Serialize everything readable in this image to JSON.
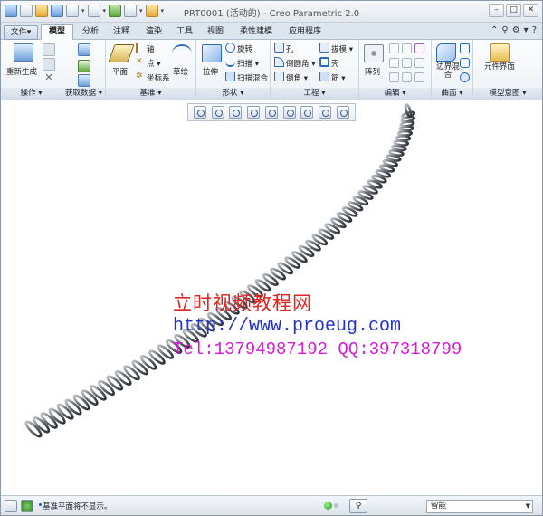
{
  "window": {
    "title": "PRT0001 (活动的) - Creo Parametric 2.0"
  },
  "tabs": [
    {
      "label": "文件",
      "dropdown": "▾"
    },
    {
      "label": "模型"
    },
    {
      "label": "分析"
    },
    {
      "label": "注释"
    },
    {
      "label": "渲染"
    },
    {
      "label": "工具"
    },
    {
      "label": "视图"
    },
    {
      "label": "柔性建模"
    },
    {
      "label": "应用程序"
    }
  ],
  "ribbon": {
    "groups": {
      "operations": "操作 ▾",
      "get_data": "获取数据 ▾",
      "datum": "基准 ▾",
      "shape": "形状 ▾",
      "engineering": "工程 ▾",
      "edit": "编辑 ▾",
      "surface": "曲面 ▾",
      "model_intent": "模型意图 ▾"
    },
    "buttons": {
      "regenerate": "重新生成",
      "plane": "平面",
      "axis": "轴",
      "point": "点 ▾",
      "csys": "坐标系",
      "sketch": "草绘",
      "extrude": "拉伸",
      "revolve": "旋转",
      "sweep": "扫描 ▾",
      "swept_blend": "扫描混合",
      "hole": "孔",
      "round": "倒圆角 ▾",
      "chamfer": "倒角 ▾",
      "draft": "拔模 ▾",
      "shell": "壳",
      "rib": "筋 ▾",
      "pattern": "阵列",
      "boundary_blend": "边界混合",
      "component_interface": "元件界面"
    }
  },
  "watermark": {
    "line1": "立时视频教程网",
    "line2": "http://www.proeug.com",
    "line3": "Tel:13794987192  QQ:397318799"
  },
  "status": {
    "message": "基准平面将不显示。",
    "filter_value": "智能"
  },
  "colors": {
    "accent": "#1d56b5",
    "watermark_red": "#e0241f",
    "watermark_blue": "#2233cc",
    "watermark_magenta": "#d31dd6"
  }
}
